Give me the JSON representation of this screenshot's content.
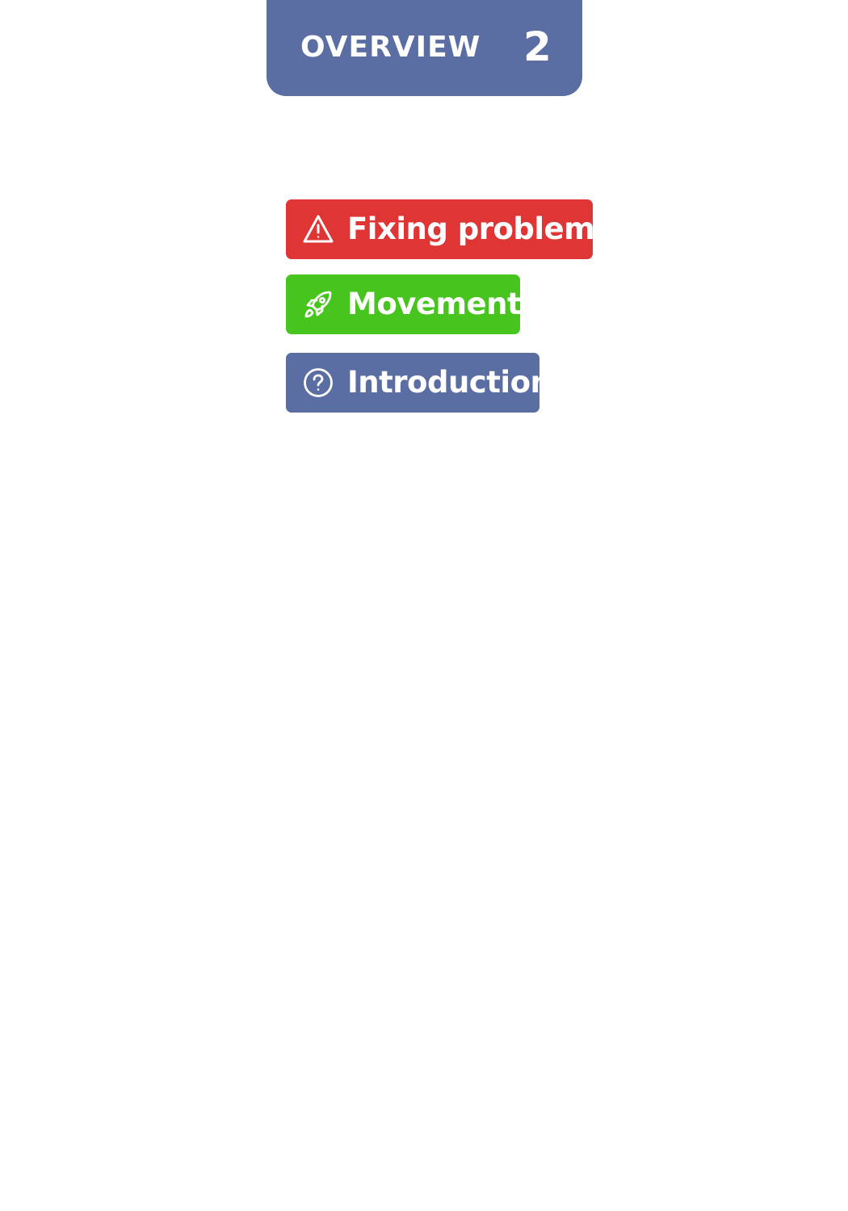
{
  "header": {
    "title": "OVERVIEW",
    "number": "2",
    "color": "#5a6ea3"
  },
  "tags": [
    {
      "label": "Fixing problems",
      "icon": "warning-triangle-icon",
      "color": "#e03535"
    },
    {
      "label": "Movement",
      "icon": "rocket-icon",
      "color": "#48c41e"
    },
    {
      "label": "Introduction",
      "icon": "question-circle-icon",
      "color": "#5a6ea3"
    }
  ]
}
